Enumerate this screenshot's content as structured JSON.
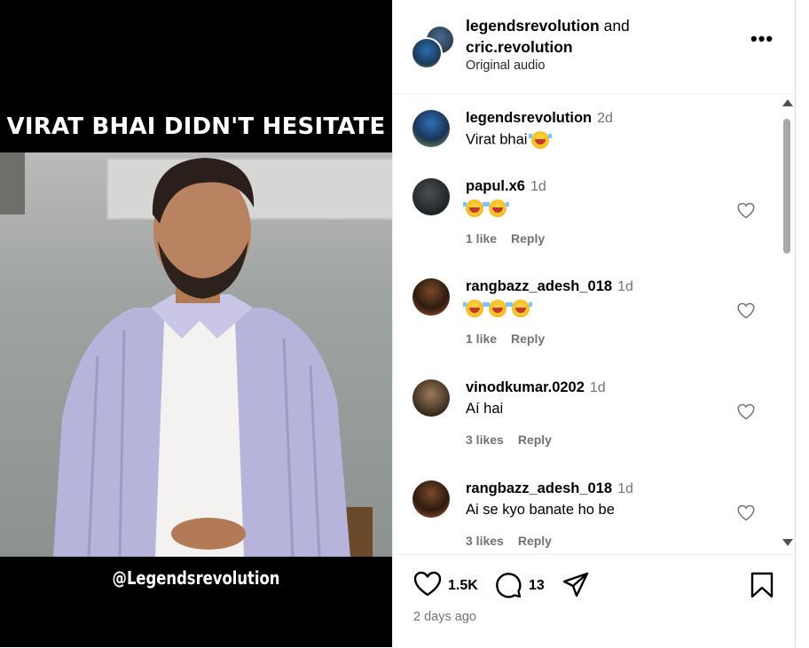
{
  "media": {
    "caption": "VIRAT BHAI DIDN'T HESITATE",
    "watermark": "@Legendsrevolution"
  },
  "header": {
    "user1": "legendsrevolution",
    "connector": "and",
    "user2": "cric.revolution",
    "audio": "Original audio",
    "more_label": "•••"
  },
  "comments": [
    {
      "user": "legendsrevolution",
      "time": "2d",
      "text": "Virat bhai",
      "emoji_count": 1,
      "likes": "",
      "reply": ""
    },
    {
      "user": "papul.x6",
      "time": "1d",
      "text": "",
      "emoji_count": 2,
      "likes": "1 like",
      "reply": "Reply"
    },
    {
      "user": "rangbazz_adesh_018",
      "time": "1d",
      "text": "",
      "emoji_count": 3,
      "likes": "1 like",
      "reply": "Reply"
    },
    {
      "user": "vinodkumar.0202",
      "time": "1d",
      "text": "Aí hai",
      "emoji_count": 0,
      "likes": "3 likes",
      "reply": "Reply"
    },
    {
      "user": "rangbazz_adesh_018",
      "time": "1d",
      "text": "Ai se kyo banate ho be",
      "emoji_count": 0,
      "likes": "3 likes",
      "reply": "Reply"
    }
  ],
  "actions": {
    "like_count": "1.5K",
    "comment_count": "13",
    "posted": "2 days ago"
  },
  "icons": {
    "like": "heart-icon",
    "comment": "comment-icon",
    "share": "send-icon",
    "save": "bookmark-icon"
  }
}
